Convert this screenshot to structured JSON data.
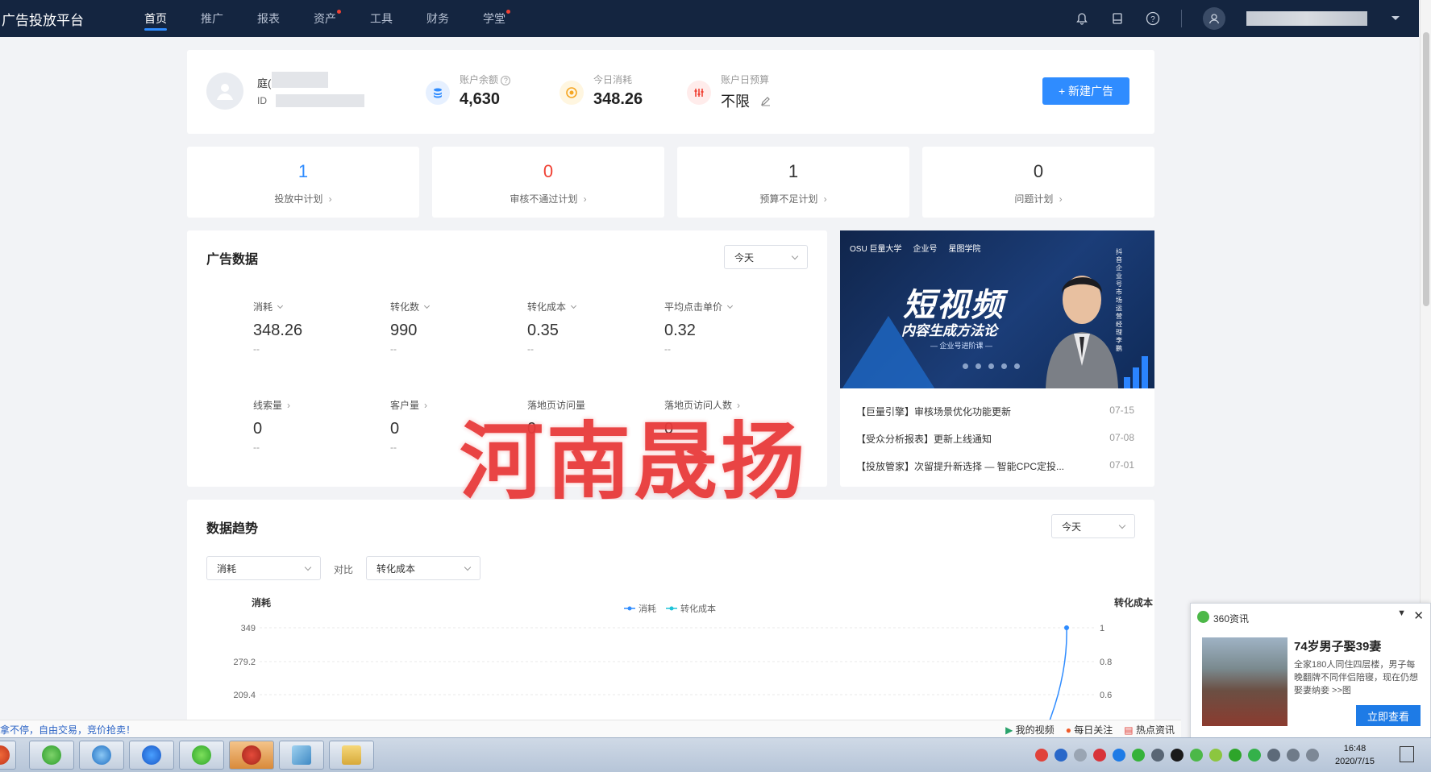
{
  "nav": {
    "brand": "广告投放平台",
    "items": [
      {
        "label": "首页",
        "active": true,
        "dot": false
      },
      {
        "label": "推广",
        "active": false,
        "dot": false
      },
      {
        "label": "报表",
        "active": false,
        "dot": false
      },
      {
        "label": "资产",
        "active": false,
        "dot": true
      },
      {
        "label": "工具",
        "active": false,
        "dot": false
      },
      {
        "label": "财务",
        "active": false,
        "dot": false
      },
      {
        "label": "学堂",
        "active": false,
        "dot": true
      }
    ],
    "icons": [
      "bell-icon",
      "document-icon",
      "help-icon",
      "user-icon",
      "dropdown-icon"
    ]
  },
  "account": {
    "name": "庭(",
    "id_label": "ID",
    "balance_label": "账户余额",
    "balance_value": "4,630",
    "today_cost_label": "今日消耗",
    "today_cost_value": "348.26",
    "daily_budget_label": "账户日预算",
    "daily_budget_value": "不限",
    "new_ad_button": "+ 新建广告"
  },
  "plans": [
    {
      "count": "1",
      "label": "投放中计划",
      "color": "#2f8cff"
    },
    {
      "count": "0",
      "label": "审核不通过计划",
      "color": "#f04134"
    },
    {
      "count": "1",
      "label": "预算不足计划",
      "color": "#333333"
    },
    {
      "count": "0",
      "label": "问题计划",
      "color": "#333333"
    }
  ],
  "ad_data": {
    "title": "广告数据",
    "range": "今天",
    "metrics": [
      {
        "label": "消耗",
        "value": "348.26",
        "sub": "--"
      },
      {
        "label": "转化数",
        "value": "990",
        "sub": "--"
      },
      {
        "label": "转化成本",
        "value": "0.35",
        "sub": "--"
      },
      {
        "label": "平均点击单价",
        "value": "0.32",
        "sub": "--"
      },
      {
        "label": "线索量",
        "value": "0",
        "sub": "--"
      },
      {
        "label": "客户量",
        "value": "0",
        "sub": "--"
      },
      {
        "label": "落地页访问量",
        "value": "0",
        "sub": ""
      },
      {
        "label": "落地页访问人数",
        "value": "0",
        "sub": ""
      }
    ]
  },
  "banner": {
    "logos": [
      "OSU 巨量大学",
      "企业号",
      "星图学院"
    ],
    "headline": "短视频",
    "subheadline": "内容生成方法论",
    "tagline": "— 企业号进阶课 —",
    "vertical_text": "抖音企业号 市场运营经理 李鹏"
  },
  "news": [
    {
      "title": "【巨量引擎】审核场景优化功能更新",
      "date": "07-15"
    },
    {
      "title": "【受众分析报表】更新上线通知",
      "date": "07-08"
    },
    {
      "title": "【投放管家】次留提升新选择 — 智能CPC定投...",
      "date": "07-01"
    }
  ],
  "watermark": "河南晟扬",
  "trend": {
    "title": "数据趋势",
    "range": "今天",
    "metric_select": "消耗",
    "compare_label": "对比",
    "compare_select": "转化成本"
  },
  "chart_data": {
    "type": "line",
    "left_axis_title": "消耗",
    "right_axis_title": "转化成本",
    "legend": [
      "消耗",
      "转化成本"
    ],
    "left_ticks": [
      "349",
      "279.2",
      "209.4"
    ],
    "right_ticks": [
      "1",
      "0.8",
      "0.6"
    ],
    "series": [
      {
        "name": "消耗",
        "color": "#2f8cff",
        "points": [
          {
            "x": "end-1",
            "y": 120
          },
          {
            "x": "end",
            "y": 349
          }
        ]
      }
    ]
  },
  "statusbar": {
    "left": "拿不停，自由交易，竞价抢卖！",
    "right": [
      "我的视频",
      "每日关注",
      "热点资讯"
    ]
  },
  "popup": {
    "source": "360资讯",
    "headline": "74岁男子娶39妻",
    "body": "全家180人同住四层楼，男子每晚翻牌不同伴侣陪寝，现在仍想娶妻纳妾 >>图",
    "button": "立即查看"
  },
  "taskbar": {
    "time": "16:48",
    "date": "2020/7/15"
  }
}
